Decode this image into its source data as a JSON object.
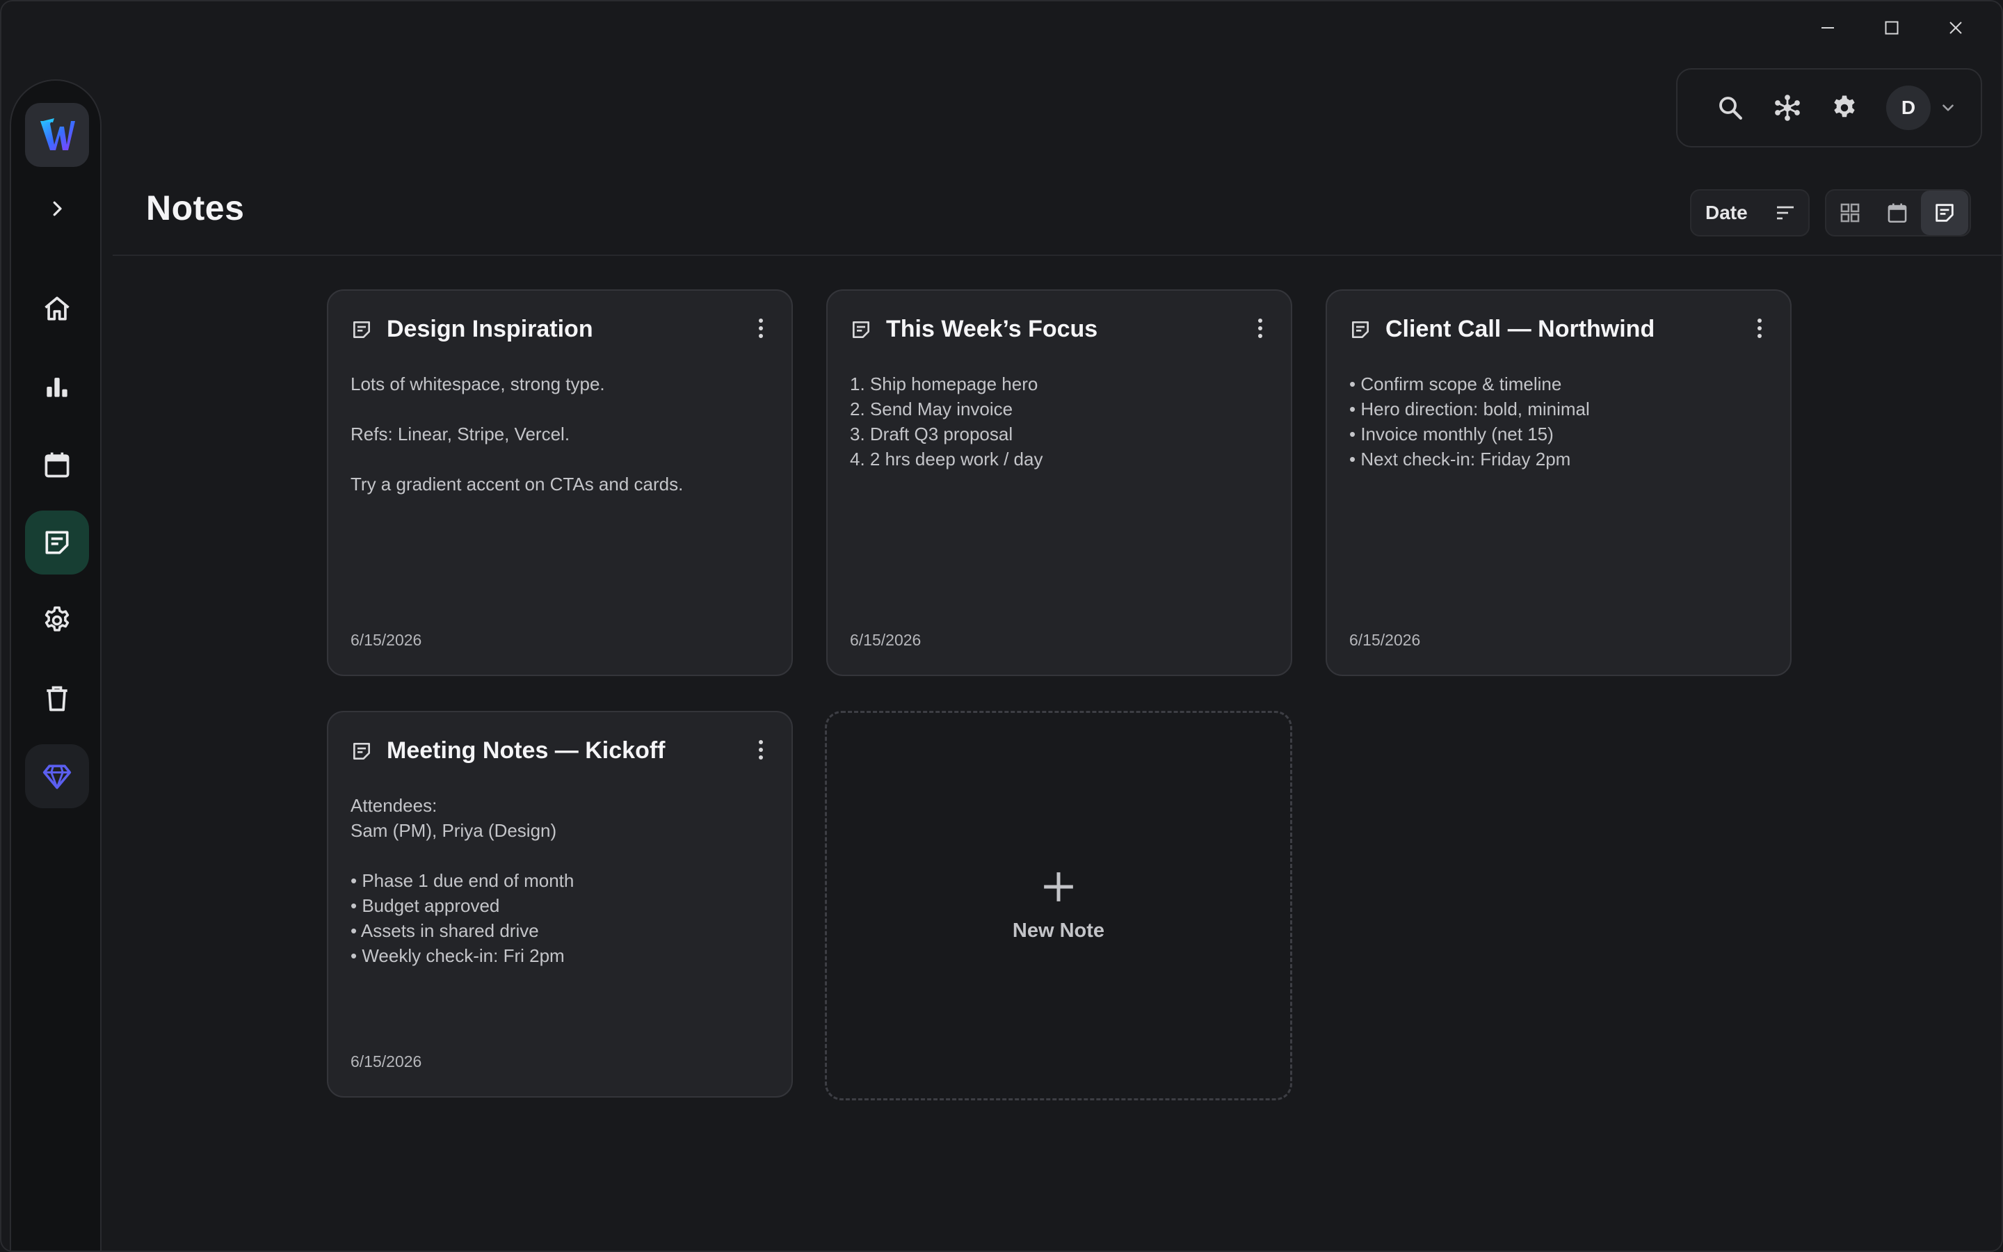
{
  "page": {
    "title": "Notes"
  },
  "app": {
    "logo_letter": "W"
  },
  "user": {
    "initial": "D"
  },
  "toolbar": {
    "sort_label": "Date",
    "views": [
      "grid-view",
      "calendar-view",
      "notes-view"
    ],
    "active_view": "notes-view"
  },
  "sidebar": {
    "items": [
      {
        "name": "home",
        "icon": "home-icon"
      },
      {
        "name": "stats",
        "icon": "bar-chart-icon"
      },
      {
        "name": "calendar",
        "icon": "calendar-icon"
      },
      {
        "name": "notes",
        "icon": "note-icon",
        "active": true
      },
      {
        "name": "settings",
        "icon": "gear-icon"
      },
      {
        "name": "trash",
        "icon": "trash-icon"
      },
      {
        "name": "premium",
        "icon": "diamond-icon"
      }
    ]
  },
  "notes": [
    {
      "title": "Design Inspiration",
      "lines": [
        "Lots of whitespace, strong type.",
        "",
        "Refs: Linear, Stripe, Vercel.",
        "",
        "Try a gradient accent on CTAs and cards."
      ],
      "date": "6/15/2026"
    },
    {
      "title": "This Week’s Focus",
      "lines": [
        "1. Ship homepage hero",
        "2. Send May invoice",
        "3. Draft Q3 proposal",
        "4. 2 hrs deep work / day"
      ],
      "date": "6/15/2026"
    },
    {
      "title": "Client Call — Northwind",
      "lines": [
        "• Confirm scope & timeline",
        "• Hero direction: bold, minimal",
        "• Invoice monthly (net 15)",
        "• Next check-in: Friday 2pm"
      ],
      "date": "6/15/2026"
    },
    {
      "title": "Meeting Notes — Kickoff",
      "lines": [
        "Attendees:",
        "Sam (PM), Priya (Design)",
        "",
        "• Phase 1 due end of month",
        "• Budget approved",
        "• Assets in shared drive",
        "• Weekly check-in: Fri 2pm"
      ],
      "date": "6/15/2026"
    }
  ],
  "new_note": {
    "label": "New Note"
  },
  "colors": {
    "background": "#18191c",
    "card": "#232428",
    "active_nav": "#173e33",
    "accent_diamond": "#5b5ff0"
  }
}
